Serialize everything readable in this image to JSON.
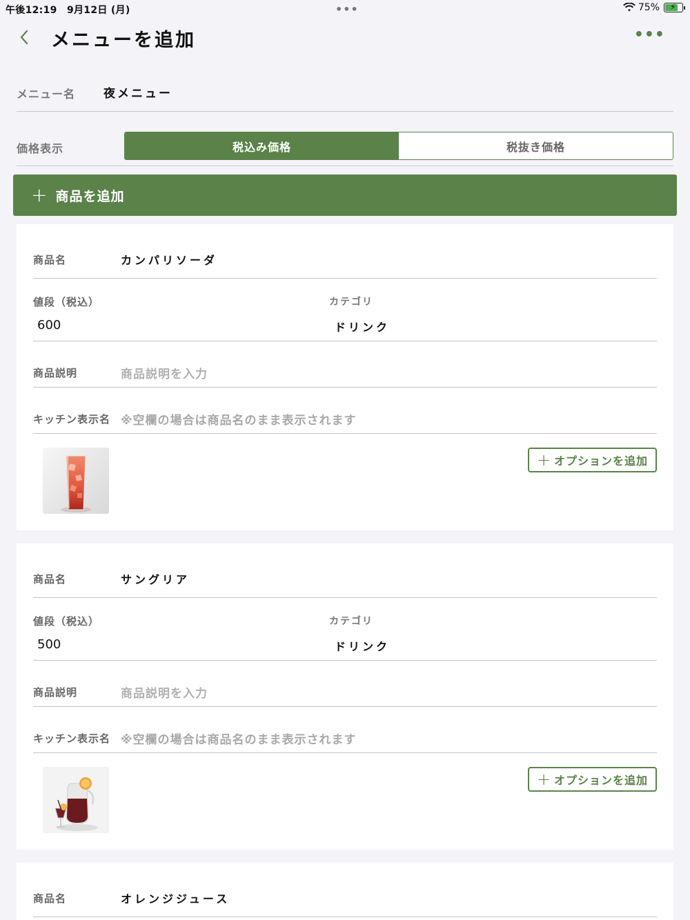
{
  "status": {
    "time_date": "午後12:19　9月12日 (月)",
    "dots": "•••",
    "battery": "75%",
    "battery_level": 0.75
  },
  "nav": {
    "title": "メニューを追加",
    "more": "•••"
  },
  "menu_name": {
    "label": "メニュー名",
    "value": "夜メニュー"
  },
  "price_display": {
    "label": "価格表示",
    "options": [
      "税込み価格",
      "税抜き価格"
    ],
    "selected": "税込み価格"
  },
  "add_product": {
    "plus": "+",
    "label": "商品を追加"
  },
  "labels": {
    "product_name": "商品名",
    "price": "値段（税込）",
    "category": "カテゴリ",
    "description": "商品説明",
    "kitchen_name": "キッチン表示名",
    "description_placeholder": "商品説明を入力",
    "kitchen_placeholder": "※空欄の場合は商品名のまま表示されます",
    "add_option": "オプションを追加",
    "plus": "+"
  },
  "products": [
    {
      "name": "カンパリソーダ",
      "price": "600",
      "category": "ドリンク",
      "image_icon": "campari-soda-photo"
    },
    {
      "name": "サングリア",
      "price": "500",
      "category": "ドリンク",
      "image_icon": "sangria-photo"
    },
    {
      "name": "オレンジジュース"
    }
  ],
  "colors": {
    "accent": "#5a8249",
    "background": "#f4f3f8"
  }
}
